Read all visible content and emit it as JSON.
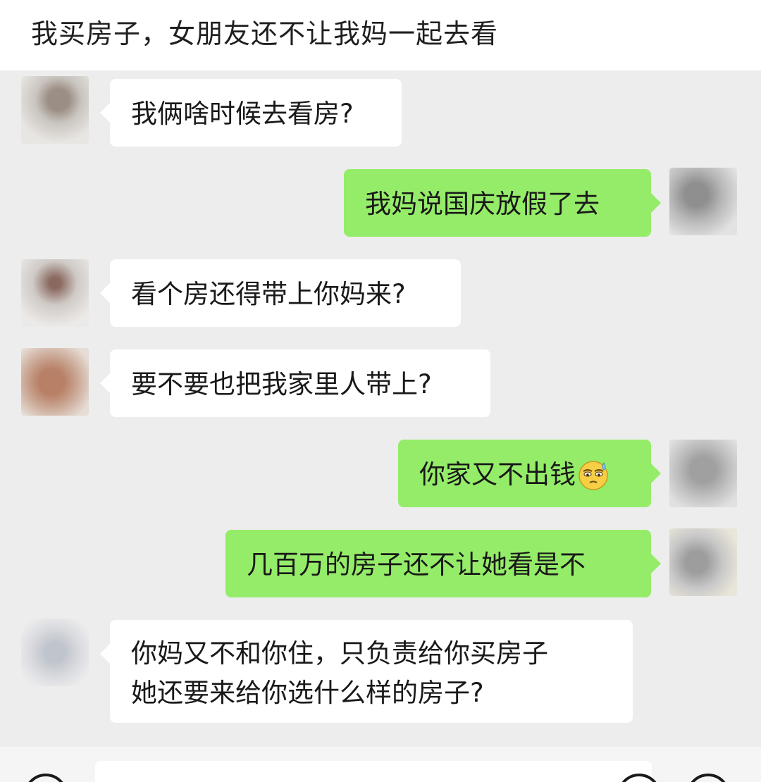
{
  "post": {
    "title": "我买房子，女朋友还不让我妈一起去看"
  },
  "chat": {
    "messages": [
      {
        "side": "left",
        "text": "我俩啥时候去看房?"
      },
      {
        "side": "right",
        "text": "我妈说国庆放假了去"
      },
      {
        "side": "left",
        "text": "看个房还得带上你妈来?"
      },
      {
        "side": "left",
        "text": "要不要也把我家里人带上?"
      },
      {
        "side": "right",
        "text": "你家又不出钱",
        "emoji": "sweat-smile-emoji"
      },
      {
        "side": "right",
        "text": "几百万的房子还不让她看是不"
      },
      {
        "side": "left",
        "text_line1": "你妈又不和你住，只负责给你买房子",
        "text_line2": "她还要来给你选什么样的房子?"
      }
    ]
  },
  "colors": {
    "chat_background": "#ededed",
    "incoming_bubble": "#ffffff",
    "outgoing_bubble": "#95ec69",
    "text": "#191919"
  },
  "input_bar": {
    "left_icon": "voice-icon",
    "right_icons": [
      "emoji-icon",
      "add-icon"
    ]
  }
}
